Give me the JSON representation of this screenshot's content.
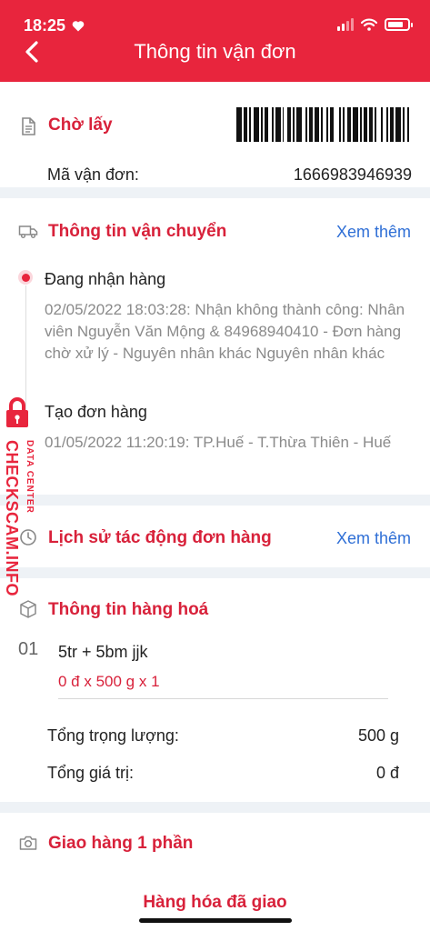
{
  "status_bar": {
    "time": "18:25"
  },
  "header": {
    "title": "Thông tin vận đơn"
  },
  "waybill": {
    "status": "Chờ lấy",
    "code_label": "Mã vận đơn:",
    "code_value": "1666983946939"
  },
  "shipping": {
    "title": "Thông tin vận chuyển",
    "more": "Xem thêm",
    "events": [
      {
        "title": "Đang nhận hàng",
        "desc": "02/05/2022 18:03:28: Nhận không thành công: Nhân viên Nguyễn Văn Mộng & 84968940410 - Đơn hàng chờ xử lý -  Nguyên nhân khác Nguyên nhân khác"
      },
      {
        "title": "Tạo đơn hàng",
        "desc": "01/05/2022 11:20:19: TP.Huế - T.Thừa Thiên - Huế"
      }
    ]
  },
  "history": {
    "title": "Lịch sử tác động đơn hàng",
    "more": "Xem thêm"
  },
  "goods": {
    "title": "Thông tin hàng hoá",
    "items": [
      {
        "index": "01",
        "name": "5tr + 5bm jjk",
        "detail": "0 đ x 500 g x 1"
      }
    ],
    "total_weight_label": "Tổng trọng lượng:",
    "total_weight_value": "500 g",
    "total_value_label": "Tổng giá trị:",
    "total_value_value": "0 đ"
  },
  "partial": {
    "title": "Giao hàng 1 phần",
    "delivered": "Hàng hóa đã giao"
  },
  "watermark": {
    "line1": "CHECKSCAM.INFO",
    "line2": "DATA CENTER"
  },
  "colors": {
    "brand": "#e8253d",
    "link": "#2f6fd6",
    "muted": "#8a8a8a"
  },
  "icons": [
    "heart-icon",
    "signal-icon",
    "wifi-icon",
    "battery-icon",
    "back-arrow-icon",
    "document-icon",
    "barcode",
    "truck-icon",
    "clock-history-icon",
    "box-icon",
    "camera-icon",
    "lock-icon"
  ]
}
